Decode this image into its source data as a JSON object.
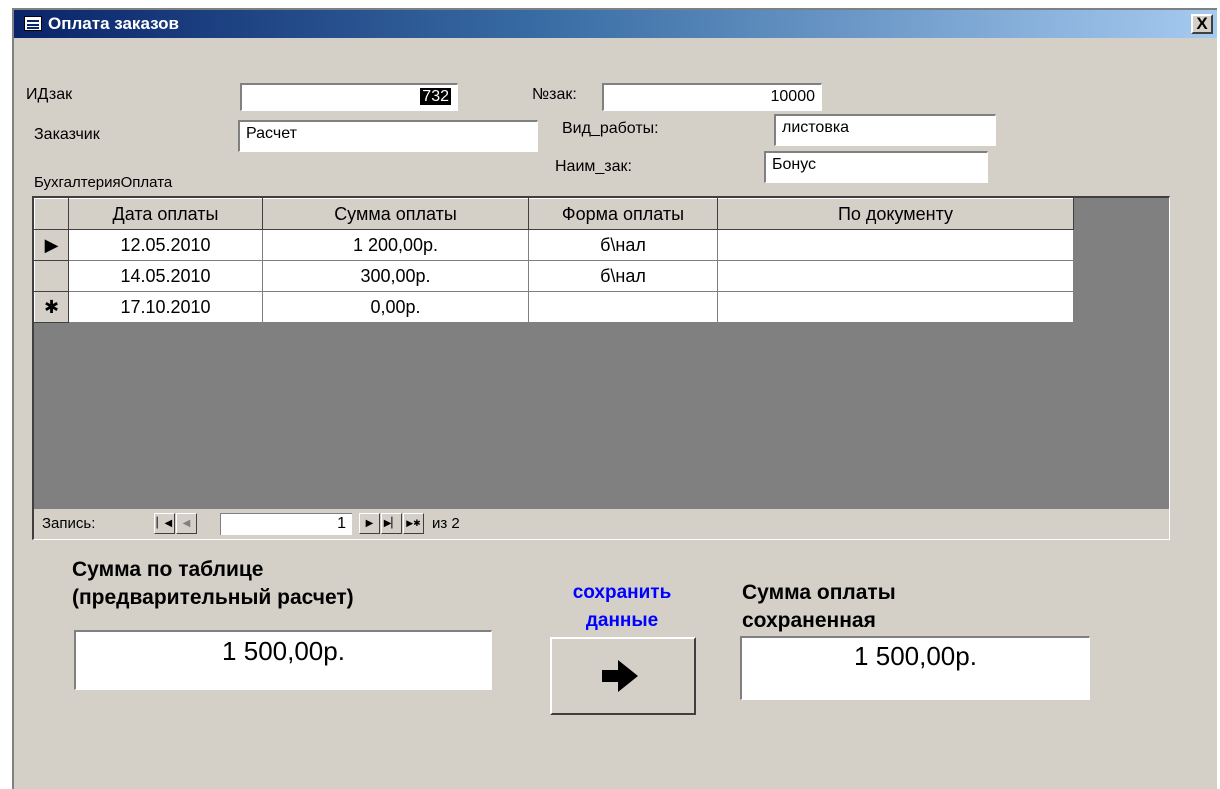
{
  "window": {
    "title": "Оплата заказов",
    "close_label": "X"
  },
  "header": {
    "id_zak_label": "ИДзак",
    "id_zak_value": "732",
    "num_zak_label": "№зак:",
    "num_zak_value": "10000",
    "customer_label": "Заказчик",
    "customer_value": "Расчет",
    "work_type_label": "Вид_работы:",
    "work_type_value": "листовка",
    "name_label": "Наим_зак:",
    "name_value": "Бонус",
    "subform_label": "БухгалтерияОплата"
  },
  "grid": {
    "columns": [
      "Дата оплаты",
      "Сумма оплаты",
      "Форма оплаты",
      "По документу"
    ],
    "rows": [
      {
        "selector": "▶",
        "date": "12.05.2010",
        "amount": "1 200,00р.",
        "form": "б\\нал",
        "doc": ""
      },
      {
        "selector": "",
        "date": "14.05.2010",
        "amount": "300,00р.",
        "form": "б\\нал",
        "doc": ""
      },
      {
        "selector": "✱",
        "date": "17.10.2010",
        "amount": "0,00р.",
        "form": "",
        "doc": ""
      }
    ]
  },
  "navigator": {
    "record_label": "Запись:",
    "current": "1",
    "of_label": "из 2",
    "first_icon": "first-record-icon",
    "prev_icon": "prev-record-icon",
    "next_icon": "next-record-icon",
    "last_icon": "last-record-icon",
    "new_icon": "new-record-icon"
  },
  "summary": {
    "table_sum_label": "Сумма по таблице\n(предварительный расчет)",
    "table_sum_value": "1 500,00р.",
    "save_label": "сохранить\nданные",
    "save_label_color": "#0000ff",
    "save_icon": "arrow-right-icon",
    "saved_sum_label": "Сумма оплаты\nсохраненная",
    "saved_sum_value": "1 500,00р."
  }
}
